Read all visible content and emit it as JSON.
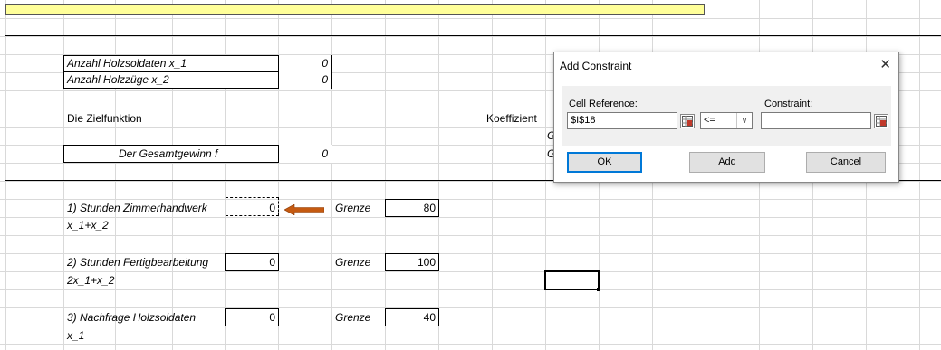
{
  "sheet": {
    "row_anzahl_holzsoldaten": {
      "label": "Anzahl Holzsoldaten  x_1",
      "value": "0"
    },
    "row_anzahl_holzzuege": {
      "label": "Anzahl Holzzüge x_2",
      "value": "0"
    },
    "zielfunktion_label": "Die Zielfunktion",
    "koeffizient_label": "Koeffizient",
    "g_label_1": "G",
    "g_label_2": "G",
    "gesamtgewinn": {
      "label": "Der Gesamtgewinn  f",
      "value": "0"
    },
    "constraints": [
      {
        "label": " 1) Stunden Zimmerhandwerk",
        "formula": "x_1+x_2",
        "value": "0",
        "grenze_label": "Grenze",
        "grenze": "80"
      },
      {
        "label": " 2) Stunden Fertigbearbeitung",
        "formula": "2x_1+x_2",
        "value": "0",
        "grenze_label": "Grenze",
        "grenze": "100"
      },
      {
        "label": "   3) Nachfrage Holzsoldaten",
        "formula": "x_1",
        "value": "0",
        "grenze_label": "Grenze",
        "grenze": "40"
      }
    ]
  },
  "dialog": {
    "title": "Add Constraint",
    "close_glyph": "✕",
    "cell_reference_label": "Cell Reference:",
    "cell_reference_value": "$I$18",
    "operator_value": "<=",
    "constraint_label": "Constraint:",
    "constraint_value": "",
    "ok_label": "OK",
    "add_label": "Add",
    "cancel_label": "Cancel"
  },
  "colors": {
    "yellow_band": "#ffff99",
    "arrow": "#c55a11",
    "dialog_button_focus": "#0078d7"
  }
}
